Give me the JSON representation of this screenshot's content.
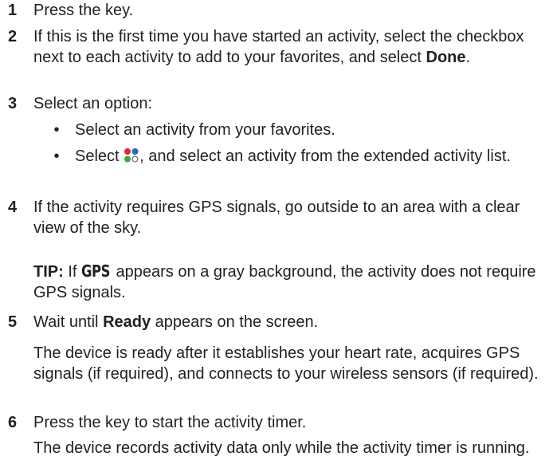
{
  "steps": [
    {
      "number": "1",
      "text": "Press the key."
    },
    {
      "number": "2",
      "text_before": "If this is the first time you have started an activity, select the checkbox next to each activity to add to your favorites, and select ",
      "bold": "Done",
      "text_after": "."
    },
    {
      "number": "3",
      "text": "Select an option:",
      "bullets": [
        {
          "text": "Select an activity from your favorites."
        },
        {
          "text_before": "Select ",
          "icon": "apps-icon",
          "text_after": ", and select an activity from the extended activity list."
        }
      ]
    },
    {
      "number": "4",
      "text": "If the activity requires GPS signals, go outside to an area with a clear view of the sky.",
      "tip_label": "TIP:",
      "tip_before": " If ",
      "tip_gps": "GPS",
      "tip_after": " appears on a gray background, the activity does not require GPS signals."
    },
    {
      "number": "5",
      "text_before": "Wait until ",
      "bold": "Ready",
      "text_after": " appears on the screen.",
      "note": "The device is ready after it establishes your heart rate, acquires GPS signals (if required), and connects to your wireless sensors (if required)."
    },
    {
      "number": "6",
      "text": "Press the key to start the activity timer.",
      "note": "The device records activity data only while the activity timer is running."
    }
  ],
  "bullet_glyph": "•",
  "icon_colors": {
    "top_left": "#e3262e",
    "top_right": "#1f6dbb",
    "bottom_left": "#3aa935",
    "bottom_right_outline": "#6d6e71"
  }
}
